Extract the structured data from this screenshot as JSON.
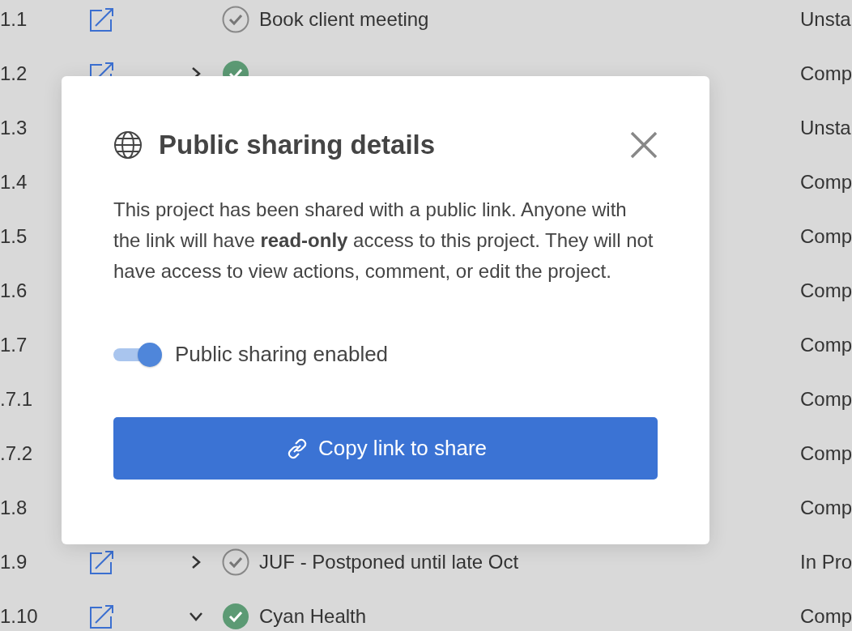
{
  "rows": [
    {
      "number": "1.1",
      "edit": true,
      "done": false,
      "title": "Book client meeting",
      "status": "Unsta"
    },
    {
      "number": "1.2",
      "edit": true,
      "chevron": {
        "expanded": false
      },
      "done": true,
      "status": "Comp"
    },
    {
      "number": "1.3",
      "status": "Unsta"
    },
    {
      "number": "1.4",
      "status": "Comp"
    },
    {
      "number": "1.5",
      "status": "Comp"
    },
    {
      "number": "1.6",
      "status": "Comp"
    },
    {
      "number": "1.7",
      "status": "Comp"
    },
    {
      "number": ".7.1",
      "status": "Comp"
    },
    {
      "number": ".7.2",
      "status": "Comp"
    },
    {
      "number": "1.8",
      "status": "Comp"
    },
    {
      "number": "1.9",
      "edit": true,
      "chevron": {
        "expanded": false
      },
      "done": false,
      "title": "JUF - Postponed until late Oct",
      "status": "In Pro"
    },
    {
      "number": "1.10",
      "edit": true,
      "chevron": {
        "expanded": true
      },
      "done": true,
      "title": "Cyan Health",
      "status": "Comp"
    }
  ],
  "dialog": {
    "title": "Public sharing details",
    "body": "This project has been shared with a public link. Anyone with the link will have **read-only** access to this project. They will not have access to view actions, comment, or edit the project.",
    "toggle": {
      "label": "Public sharing enabled",
      "on": true
    },
    "button": "Copy link to share"
  }
}
